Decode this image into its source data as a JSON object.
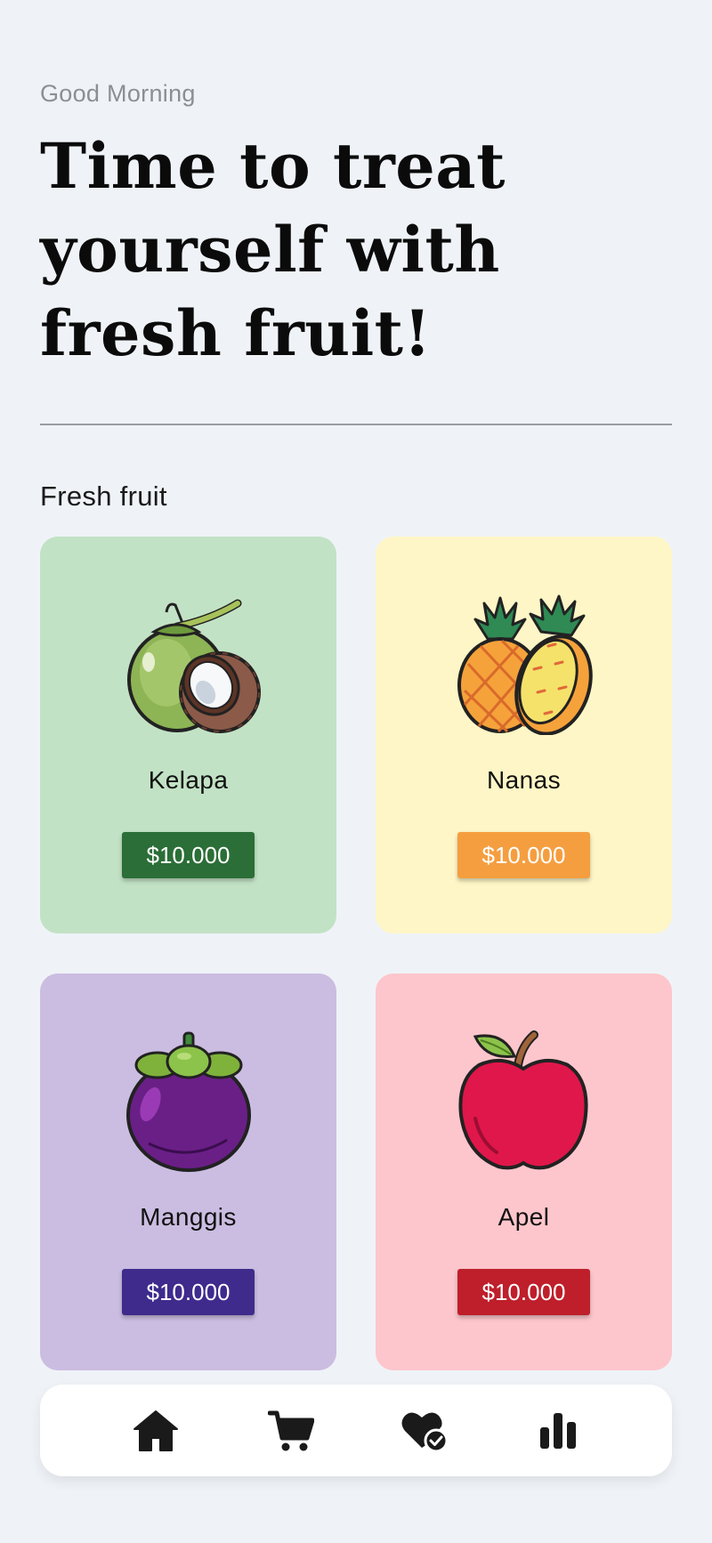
{
  "header": {
    "greeting": "Good Morning",
    "headline": "Time to treat yourself with fresh fruit!"
  },
  "section": {
    "title": "Fresh fruit"
  },
  "products": [
    {
      "name": "Kelapa",
      "price": "$10.000",
      "icon": "coconut-icon",
      "bg_color": "#c2e2c5",
      "button_color": "#2b6e37"
    },
    {
      "name": "Nanas",
      "price": "$10.000",
      "icon": "pineapple-icon",
      "bg_color": "#fef6c6",
      "button_color": "#f59e40"
    },
    {
      "name": "Manggis",
      "price": "$10.000",
      "icon": "mangosteen-icon",
      "bg_color": "#cbbde1",
      "button_color": "#3f2b8c"
    },
    {
      "name": "Apel",
      "price": "$10.000",
      "icon": "apple-icon",
      "bg_color": "#fdc6cc",
      "button_color": "#be1f2b"
    }
  ],
  "nav": {
    "items": [
      {
        "icon": "home-icon"
      },
      {
        "icon": "cart-icon"
      },
      {
        "icon": "heart-check-icon"
      },
      {
        "icon": "bar-chart-icon"
      }
    ]
  }
}
